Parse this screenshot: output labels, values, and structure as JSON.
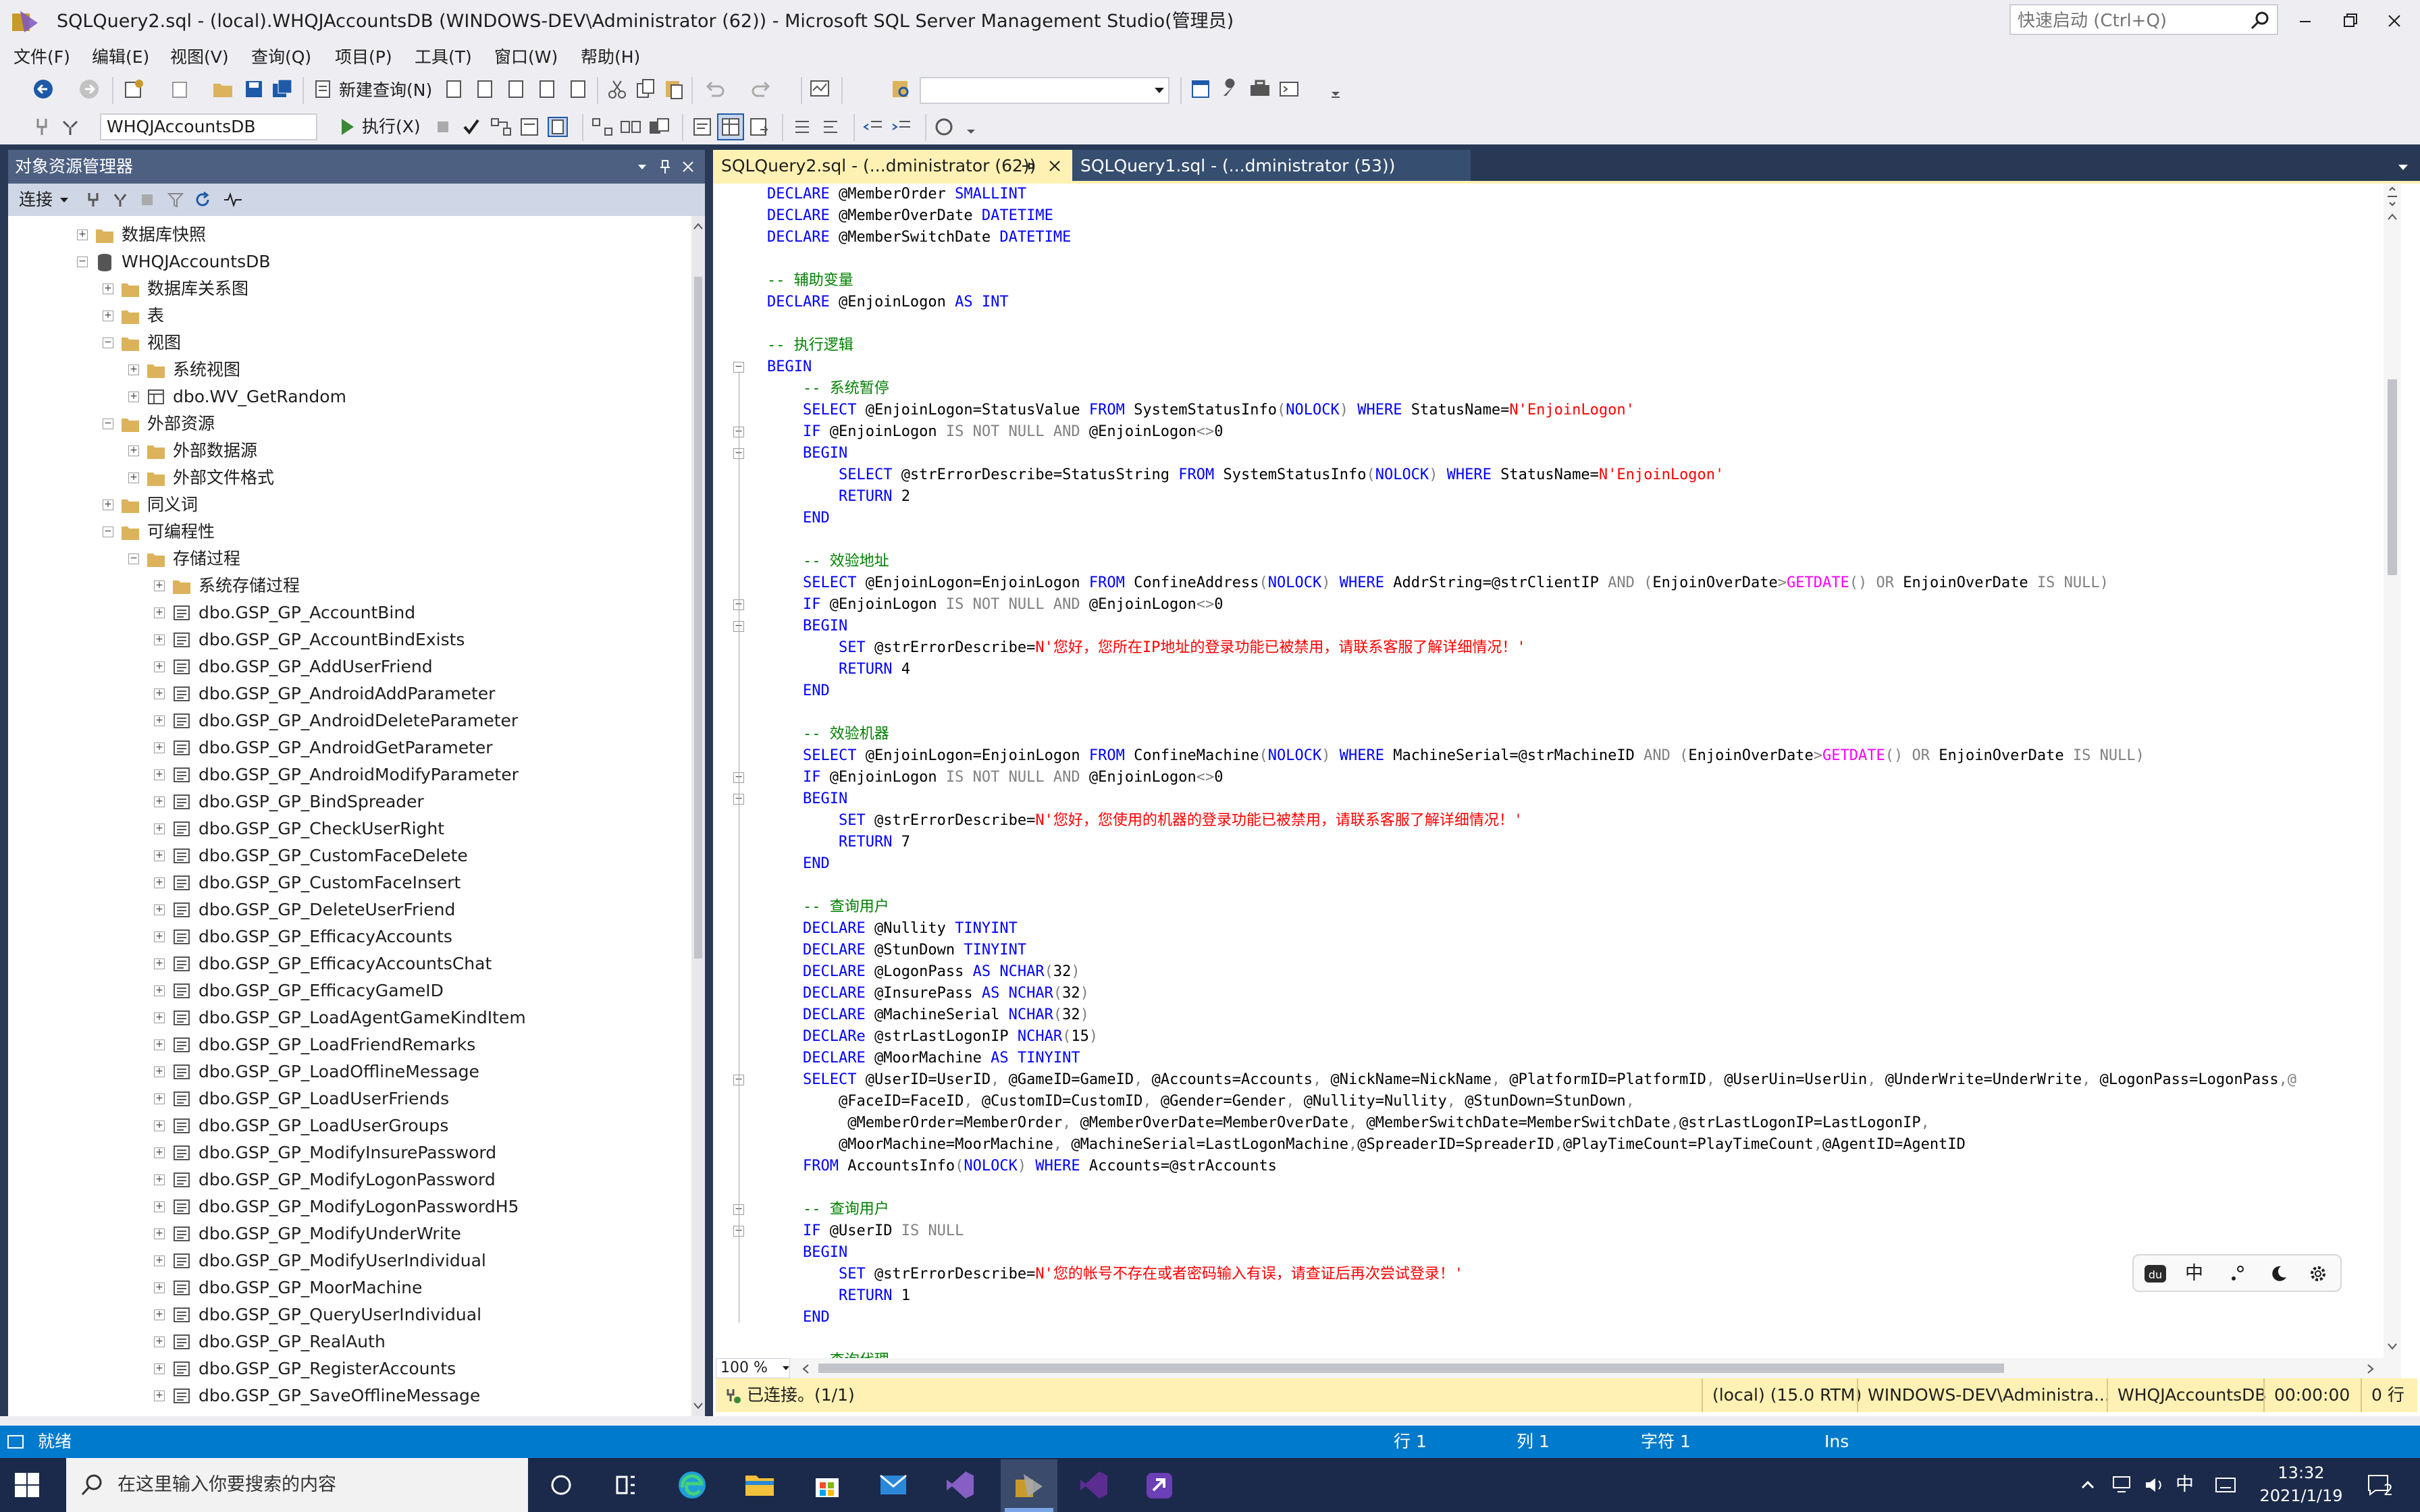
{
  "window": {
    "title": "SQLQuery2.sql - (local).WHQJAccountsDB (WINDOWS-DEV\\Administrator (62)) - Microsoft SQL Server Management Studio(管理员)",
    "quick_launch_placeholder": "快速启动 (Ctrl+Q)"
  },
  "menu": [
    "文件(F)",
    "编辑(E)",
    "视图(V)",
    "查询(Q)",
    "项目(P)",
    "工具(T)",
    "窗口(W)",
    "帮助(H)"
  ],
  "toolbar": {
    "new_query": "新建查询(N)",
    "database": "WHQJAccountsDB",
    "execute": "执行(X)"
  },
  "object_explorer": {
    "title": "对象资源管理器",
    "connect": "连接",
    "tree": [
      {
        "label": "数据库快照",
        "level": 0,
        "icon": "folder",
        "expanded": false
      },
      {
        "label": "WHQJAccountsDB",
        "level": 0,
        "icon": "database",
        "expanded": true
      },
      {
        "label": "数据库关系图",
        "level": 1,
        "icon": "folder",
        "expanded": false
      },
      {
        "label": "表",
        "level": 1,
        "icon": "folder",
        "expanded": false
      },
      {
        "label": "视图",
        "level": 1,
        "icon": "folder",
        "expanded": true
      },
      {
        "label": "系统视图",
        "level": 2,
        "icon": "folder",
        "expanded": false
      },
      {
        "label": "dbo.WV_GetRandom",
        "level": 2,
        "icon": "view",
        "expanded": false
      },
      {
        "label": "外部资源",
        "level": 1,
        "icon": "folder",
        "expanded": true
      },
      {
        "label": "外部数据源",
        "level": 2,
        "icon": "folder",
        "expanded": false
      },
      {
        "label": "外部文件格式",
        "level": 2,
        "icon": "folder",
        "expanded": false
      },
      {
        "label": "同义词",
        "level": 1,
        "icon": "folder",
        "expanded": false
      },
      {
        "label": "可编程性",
        "level": 1,
        "icon": "folder",
        "expanded": true
      },
      {
        "label": "存储过程",
        "level": 2,
        "icon": "folder",
        "expanded": true
      },
      {
        "label": "系统存储过程",
        "level": 3,
        "icon": "folder",
        "expanded": false
      },
      {
        "label": "dbo.GSP_GP_AccountBind",
        "level": 3,
        "icon": "proc",
        "expanded": false
      },
      {
        "label": "dbo.GSP_GP_AccountBindExists",
        "level": 3,
        "icon": "proc",
        "expanded": false
      },
      {
        "label": "dbo.GSP_GP_AddUserFriend",
        "level": 3,
        "icon": "proc",
        "expanded": false
      },
      {
        "label": "dbo.GSP_GP_AndroidAddParameter",
        "level": 3,
        "icon": "proc",
        "expanded": false
      },
      {
        "label": "dbo.GSP_GP_AndroidDeleteParameter",
        "level": 3,
        "icon": "proc",
        "expanded": false
      },
      {
        "label": "dbo.GSP_GP_AndroidGetParameter",
        "level": 3,
        "icon": "proc",
        "expanded": false
      },
      {
        "label": "dbo.GSP_GP_AndroidModifyParameter",
        "level": 3,
        "icon": "proc",
        "expanded": false
      },
      {
        "label": "dbo.GSP_GP_BindSpreader",
        "level": 3,
        "icon": "proc",
        "expanded": false
      },
      {
        "label": "dbo.GSP_GP_CheckUserRight",
        "level": 3,
        "icon": "proc",
        "expanded": false
      },
      {
        "label": "dbo.GSP_GP_CustomFaceDelete",
        "level": 3,
        "icon": "proc",
        "expanded": false
      },
      {
        "label": "dbo.GSP_GP_CustomFaceInsert",
        "level": 3,
        "icon": "proc",
        "expanded": false
      },
      {
        "label": "dbo.GSP_GP_DeleteUserFriend",
        "level": 3,
        "icon": "proc",
        "expanded": false
      },
      {
        "label": "dbo.GSP_GP_EfficacyAccounts",
        "level": 3,
        "icon": "proc",
        "expanded": false
      },
      {
        "label": "dbo.GSP_GP_EfficacyAccountsChat",
        "level": 3,
        "icon": "proc",
        "expanded": false
      },
      {
        "label": "dbo.GSP_GP_EfficacyGameID",
        "level": 3,
        "icon": "proc",
        "expanded": false
      },
      {
        "label": "dbo.GSP_GP_LoadAgentGameKindItem",
        "level": 3,
        "icon": "proc",
        "expanded": false
      },
      {
        "label": "dbo.GSP_GP_LoadFriendRemarks",
        "level": 3,
        "icon": "proc",
        "expanded": false
      },
      {
        "label": "dbo.GSP_GP_LoadOfflineMessage",
        "level": 3,
        "icon": "proc",
        "expanded": false
      },
      {
        "label": "dbo.GSP_GP_LoadUserFriends",
        "level": 3,
        "icon": "proc",
        "expanded": false
      },
      {
        "label": "dbo.GSP_GP_LoadUserGroups",
        "level": 3,
        "icon": "proc",
        "expanded": false
      },
      {
        "label": "dbo.GSP_GP_ModifyInsurePassword",
        "level": 3,
        "icon": "proc",
        "expanded": false
      },
      {
        "label": "dbo.GSP_GP_ModifyLogonPassword",
        "level": 3,
        "icon": "proc",
        "expanded": false
      },
      {
        "label": "dbo.GSP_GP_ModifyLogonPasswordH5",
        "level": 3,
        "icon": "proc",
        "expanded": false
      },
      {
        "label": "dbo.GSP_GP_ModifyUnderWrite",
        "level": 3,
        "icon": "proc",
        "expanded": false
      },
      {
        "label": "dbo.GSP_GP_ModifyUserIndividual",
        "level": 3,
        "icon": "proc",
        "expanded": false
      },
      {
        "label": "dbo.GSP_GP_MoorMachine",
        "level": 3,
        "icon": "proc",
        "expanded": false
      },
      {
        "label": "dbo.GSP_GP_QueryUserIndividual",
        "level": 3,
        "icon": "proc",
        "expanded": false
      },
      {
        "label": "dbo.GSP_GP_RealAuth",
        "level": 3,
        "icon": "proc",
        "expanded": false
      },
      {
        "label": "dbo.GSP_GP_RegisterAccounts",
        "level": 3,
        "icon": "proc",
        "expanded": false
      },
      {
        "label": "dbo.GSP_GP_SaveOfflineMessage",
        "level": 3,
        "icon": "proc",
        "expanded": false
      }
    ]
  },
  "tabs": [
    {
      "label": "SQLQuery2.sql - (...dministrator (62))",
      "active": true
    },
    {
      "label": "SQLQuery1.sql - (...dministrator (53))",
      "active": false
    }
  ],
  "code_lines": [
    [
      [
        "kw",
        "DECLARE "
      ],
      [
        "tx",
        "@MemberOrder "
      ],
      [
        "kw",
        "SMALLINT"
      ]
    ],
    [
      [
        "kw",
        "DECLARE "
      ],
      [
        "tx",
        "@MemberOverDate "
      ],
      [
        "kw",
        "DATETIME"
      ]
    ],
    [
      [
        "kw",
        "DECLARE "
      ],
      [
        "tx",
        "@MemberSwitchDate "
      ],
      [
        "kw",
        "DATETIME"
      ]
    ],
    [],
    [
      [
        "cm",
        "-- 辅助变量"
      ]
    ],
    [
      [
        "kw",
        "DECLARE "
      ],
      [
        "tx",
        "@EnjoinLogon "
      ],
      [
        "kw",
        "AS INT"
      ]
    ],
    [],
    [
      [
        "cm",
        "-- 执行逻辑"
      ]
    ],
    [
      [
        "kw",
        "BEGIN"
      ]
    ],
    [
      [
        "tx",
        "    "
      ],
      [
        "cm",
        "-- 系统暂停"
      ]
    ],
    [
      [
        "tx",
        "    "
      ],
      [
        "kw",
        "SELECT "
      ],
      [
        "tx",
        "@EnjoinLogon=StatusValue "
      ],
      [
        "kw",
        "FROM "
      ],
      [
        "tx",
        "SystemStatusInfo"
      ],
      [
        "gr",
        "("
      ],
      [
        "kw",
        "NOLOCK"
      ],
      [
        "gr",
        ")"
      ],
      [
        "kw",
        " WHERE "
      ],
      [
        "tx",
        "StatusName="
      ],
      [
        "st",
        "N'EnjoinLogon'"
      ]
    ],
    [
      [
        "tx",
        "    "
      ],
      [
        "kw",
        "IF "
      ],
      [
        "tx",
        "@EnjoinLogon "
      ],
      [
        "gr",
        "IS NOT NULL AND "
      ],
      [
        "tx",
        "@EnjoinLogon"
      ],
      [
        "gr",
        "<>"
      ],
      [
        "tx",
        "0"
      ]
    ],
    [
      [
        "tx",
        "    "
      ],
      [
        "kw",
        "BEGIN"
      ]
    ],
    [
      [
        "tx",
        "        "
      ],
      [
        "kw",
        "SELECT "
      ],
      [
        "tx",
        "@strErrorDescribe=StatusString "
      ],
      [
        "kw",
        "FROM "
      ],
      [
        "tx",
        "SystemStatusInfo"
      ],
      [
        "gr",
        "("
      ],
      [
        "kw",
        "NOLOCK"
      ],
      [
        "gr",
        ")"
      ],
      [
        "kw",
        " WHERE "
      ],
      [
        "tx",
        "StatusName="
      ],
      [
        "st",
        "N'EnjoinLogon'"
      ]
    ],
    [
      [
        "tx",
        "        "
      ],
      [
        "kw",
        "RETURN "
      ],
      [
        "tx",
        "2"
      ]
    ],
    [
      [
        "tx",
        "    "
      ],
      [
        "kw",
        "END"
      ]
    ],
    [],
    [
      [
        "tx",
        "    "
      ],
      [
        "cm",
        "-- 效验地址"
      ]
    ],
    [
      [
        "tx",
        "    "
      ],
      [
        "kw",
        "SELECT "
      ],
      [
        "tx",
        "@EnjoinLogon=EnjoinLogon "
      ],
      [
        "kw",
        "FROM "
      ],
      [
        "tx",
        "ConfineAddress"
      ],
      [
        "gr",
        "("
      ],
      [
        "kw",
        "NOLOCK"
      ],
      [
        "gr",
        ")"
      ],
      [
        "kw",
        " WHERE "
      ],
      [
        "tx",
        "AddrString=@strClientIP "
      ],
      [
        "gr",
        "AND ("
      ],
      [
        "tx",
        "EnjoinOverDate"
      ],
      [
        "gr",
        ">"
      ],
      [
        "fn",
        "GETDATE"
      ],
      [
        "gr",
        "() OR "
      ],
      [
        "tx",
        "EnjoinOverDate "
      ],
      [
        "gr",
        "IS NULL)"
      ]
    ],
    [
      [
        "tx",
        "    "
      ],
      [
        "kw",
        "IF "
      ],
      [
        "tx",
        "@EnjoinLogon "
      ],
      [
        "gr",
        "IS NOT NULL AND "
      ],
      [
        "tx",
        "@EnjoinLogon"
      ],
      [
        "gr",
        "<>"
      ],
      [
        "tx",
        "0"
      ]
    ],
    [
      [
        "tx",
        "    "
      ],
      [
        "kw",
        "BEGIN"
      ]
    ],
    [
      [
        "tx",
        "        "
      ],
      [
        "kw",
        "SET "
      ],
      [
        "tx",
        "@strErrorDescribe="
      ],
      [
        "st",
        "N'您好，您所在IP地址的登录功能已被禁用，请联系客服了解详细情况！'"
      ]
    ],
    [
      [
        "tx",
        "        "
      ],
      [
        "kw",
        "RETURN "
      ],
      [
        "tx",
        "4"
      ]
    ],
    [
      [
        "tx",
        "    "
      ],
      [
        "kw",
        "END"
      ]
    ],
    [],
    [
      [
        "tx",
        "    "
      ],
      [
        "cm",
        "-- 效验机器"
      ]
    ],
    [
      [
        "tx",
        "    "
      ],
      [
        "kw",
        "SELECT "
      ],
      [
        "tx",
        "@EnjoinLogon=EnjoinLogon "
      ],
      [
        "kw",
        "FROM "
      ],
      [
        "tx",
        "ConfineMachine"
      ],
      [
        "gr",
        "("
      ],
      [
        "kw",
        "NOLOCK"
      ],
      [
        "gr",
        ")"
      ],
      [
        "kw",
        " WHERE "
      ],
      [
        "tx",
        "MachineSerial=@strMachineID "
      ],
      [
        "gr",
        "AND ("
      ],
      [
        "tx",
        "EnjoinOverDate"
      ],
      [
        "gr",
        ">"
      ],
      [
        "fn",
        "GETDATE"
      ],
      [
        "gr",
        "() OR "
      ],
      [
        "tx",
        "EnjoinOverDate "
      ],
      [
        "gr",
        "IS NULL)"
      ]
    ],
    [
      [
        "tx",
        "    "
      ],
      [
        "kw",
        "IF "
      ],
      [
        "tx",
        "@EnjoinLogon "
      ],
      [
        "gr",
        "IS NOT NULL AND "
      ],
      [
        "tx",
        "@EnjoinLogon"
      ],
      [
        "gr",
        "<>"
      ],
      [
        "tx",
        "0"
      ]
    ],
    [
      [
        "tx",
        "    "
      ],
      [
        "kw",
        "BEGIN"
      ]
    ],
    [
      [
        "tx",
        "        "
      ],
      [
        "kw",
        "SET "
      ],
      [
        "tx",
        "@strErrorDescribe="
      ],
      [
        "st",
        "N'您好，您使用的机器的登录功能已被禁用，请联系客服了解详细情况！'"
      ]
    ],
    [
      [
        "tx",
        "        "
      ],
      [
        "kw",
        "RETURN "
      ],
      [
        "tx",
        "7"
      ]
    ],
    [
      [
        "tx",
        "    "
      ],
      [
        "kw",
        "END"
      ]
    ],
    [],
    [
      [
        "tx",
        "    "
      ],
      [
        "cm",
        "-- 查询用户"
      ]
    ],
    [
      [
        "tx",
        "    "
      ],
      [
        "kw",
        "DECLARE "
      ],
      [
        "tx",
        "@Nullity "
      ],
      [
        "kw",
        "TINYINT"
      ]
    ],
    [
      [
        "tx",
        "    "
      ],
      [
        "kw",
        "DECLARE "
      ],
      [
        "tx",
        "@StunDown "
      ],
      [
        "kw",
        "TINYINT"
      ]
    ],
    [
      [
        "tx",
        "    "
      ],
      [
        "kw",
        "DECLARE "
      ],
      [
        "tx",
        "@LogonPass "
      ],
      [
        "kw",
        "AS NCHAR"
      ],
      [
        "gr",
        "("
      ],
      [
        "tx",
        "32"
      ],
      [
        "gr",
        ")"
      ]
    ],
    [
      [
        "tx",
        "    "
      ],
      [
        "kw",
        "DECLARE "
      ],
      [
        "tx",
        "@InsurePass "
      ],
      [
        "kw",
        "AS NCHAR"
      ],
      [
        "gr",
        "("
      ],
      [
        "tx",
        "32"
      ],
      [
        "gr",
        ")"
      ]
    ],
    [
      [
        "tx",
        "    "
      ],
      [
        "kw",
        "DECLARE "
      ],
      [
        "tx",
        "@MachineSerial "
      ],
      [
        "kw",
        "NCHAR"
      ],
      [
        "gr",
        "("
      ],
      [
        "tx",
        "32"
      ],
      [
        "gr",
        ")"
      ]
    ],
    [
      [
        "tx",
        "    "
      ],
      [
        "kw",
        "DECLARe "
      ],
      [
        "tx",
        "@strLastLogonIP "
      ],
      [
        "kw",
        "NCHAR"
      ],
      [
        "gr",
        "("
      ],
      [
        "tx",
        "15"
      ],
      [
        "gr",
        ")"
      ]
    ],
    [
      [
        "tx",
        "    "
      ],
      [
        "kw",
        "DECLARE "
      ],
      [
        "tx",
        "@MoorMachine "
      ],
      [
        "kw",
        "AS TINYINT"
      ]
    ],
    [
      [
        "tx",
        "    "
      ],
      [
        "kw",
        "SELECT "
      ],
      [
        "tx",
        "@UserID=UserID"
      ],
      [
        "gr",
        ", "
      ],
      [
        "tx",
        "@GameID=GameID"
      ],
      [
        "gr",
        ", "
      ],
      [
        "tx",
        "@Accounts=Accounts"
      ],
      [
        "gr",
        ", "
      ],
      [
        "tx",
        "@NickName=NickName"
      ],
      [
        "gr",
        ", "
      ],
      [
        "tx",
        "@PlatformID=PlatformID"
      ],
      [
        "gr",
        ", "
      ],
      [
        "tx",
        "@UserUin=UserUin"
      ],
      [
        "gr",
        ", "
      ],
      [
        "tx",
        "@UnderWrite=UnderWrite"
      ],
      [
        "gr",
        ", "
      ],
      [
        "tx",
        "@LogonPass=LogonPass"
      ],
      [
        "gr",
        ",@"
      ]
    ],
    [
      [
        "tx",
        "        @FaceID=FaceID"
      ],
      [
        "gr",
        ", "
      ],
      [
        "tx",
        "@CustomID=CustomID"
      ],
      [
        "gr",
        ", "
      ],
      [
        "tx",
        "@Gender=Gender"
      ],
      [
        "gr",
        ", "
      ],
      [
        "tx",
        "@Nullity=Nullity"
      ],
      [
        "gr",
        ", "
      ],
      [
        "tx",
        "@StunDown=StunDown"
      ],
      [
        "gr",
        ","
      ]
    ],
    [
      [
        "tx",
        "         @MemberOrder=MemberOrder"
      ],
      [
        "gr",
        ", "
      ],
      [
        "tx",
        "@MemberOverDate=MemberOverDate"
      ],
      [
        "gr",
        ", "
      ],
      [
        "tx",
        "@MemberSwitchDate=MemberSwitchDate"
      ],
      [
        "gr",
        ","
      ],
      [
        "tx",
        "@strLastLogonIP=LastLogonIP"
      ],
      [
        "gr",
        ","
      ]
    ],
    [
      [
        "tx",
        "        @MoorMachine=MoorMachine"
      ],
      [
        "gr",
        ", "
      ],
      [
        "tx",
        "@MachineSerial=LastLogonMachine"
      ],
      [
        "gr",
        ","
      ],
      [
        "tx",
        "@SpreaderID=SpreaderID"
      ],
      [
        "gr",
        ","
      ],
      [
        "tx",
        "@PlayTimeCount=PlayTimeCount"
      ],
      [
        "gr",
        ","
      ],
      [
        "tx",
        "@AgentID=AgentID"
      ]
    ],
    [
      [
        "tx",
        "    "
      ],
      [
        "kw",
        "FROM "
      ],
      [
        "tx",
        "AccountsInfo"
      ],
      [
        "gr",
        "("
      ],
      [
        "kw",
        "NOLOCK"
      ],
      [
        "gr",
        ")"
      ],
      [
        "kw",
        " WHERE "
      ],
      [
        "tx",
        "Accounts=@strAccounts"
      ]
    ],
    [],
    [
      [
        "tx",
        "    "
      ],
      [
        "cm",
        "-- 查询用户"
      ]
    ],
    [
      [
        "tx",
        "    "
      ],
      [
        "kw",
        "IF "
      ],
      [
        "tx",
        "@UserID "
      ],
      [
        "gr",
        "IS NULL"
      ]
    ],
    [
      [
        "tx",
        "    "
      ],
      [
        "kw",
        "BEGIN"
      ]
    ],
    [
      [
        "tx",
        "        "
      ],
      [
        "kw",
        "SET "
      ],
      [
        "tx",
        "@strErrorDescribe="
      ],
      [
        "st",
        "N'您的帐号不存在或者密码输入有误，请查证后再次尝试登录！'"
      ]
    ],
    [
      [
        "tx",
        "        "
      ],
      [
        "kw",
        "RETURN "
      ],
      [
        "tx",
        "1"
      ]
    ],
    [
      [
        "tx",
        "    "
      ],
      [
        "kw",
        "END"
      ]
    ],
    [],
    [
      [
        "tx",
        "    "
      ],
      [
        "cm",
        "-- 查询代理"
      ]
    ]
  ],
  "editor": {
    "zoom": "100 %"
  },
  "query_status": {
    "connected": "已连接。(1/1)",
    "server": "(local) (15.0 RTM)",
    "user": "WINDOWS-DEV\\Administra...",
    "database": "WHQJAccountsDB",
    "elapsed": "00:00:00",
    "rows": "0 行"
  },
  "statusbar": {
    "ready": "就绪",
    "line": "行 1",
    "col": "列 1",
    "ch": "字符 1",
    "mode": "Ins"
  },
  "taskbar": {
    "search_placeholder": "在这里输入你要搜索的内容",
    "time": "13:32",
    "date": "2021/1/19",
    "ime": "中",
    "notification_count": "2"
  },
  "colors": {
    "keyword": "#0000ff",
    "comment": "#008000",
    "string": "#ff0000",
    "function": "#ff00ff",
    "operator": "#808080",
    "accent": "#007acc",
    "tool_window_header": "#4d6082",
    "background_navy": "#293955"
  }
}
